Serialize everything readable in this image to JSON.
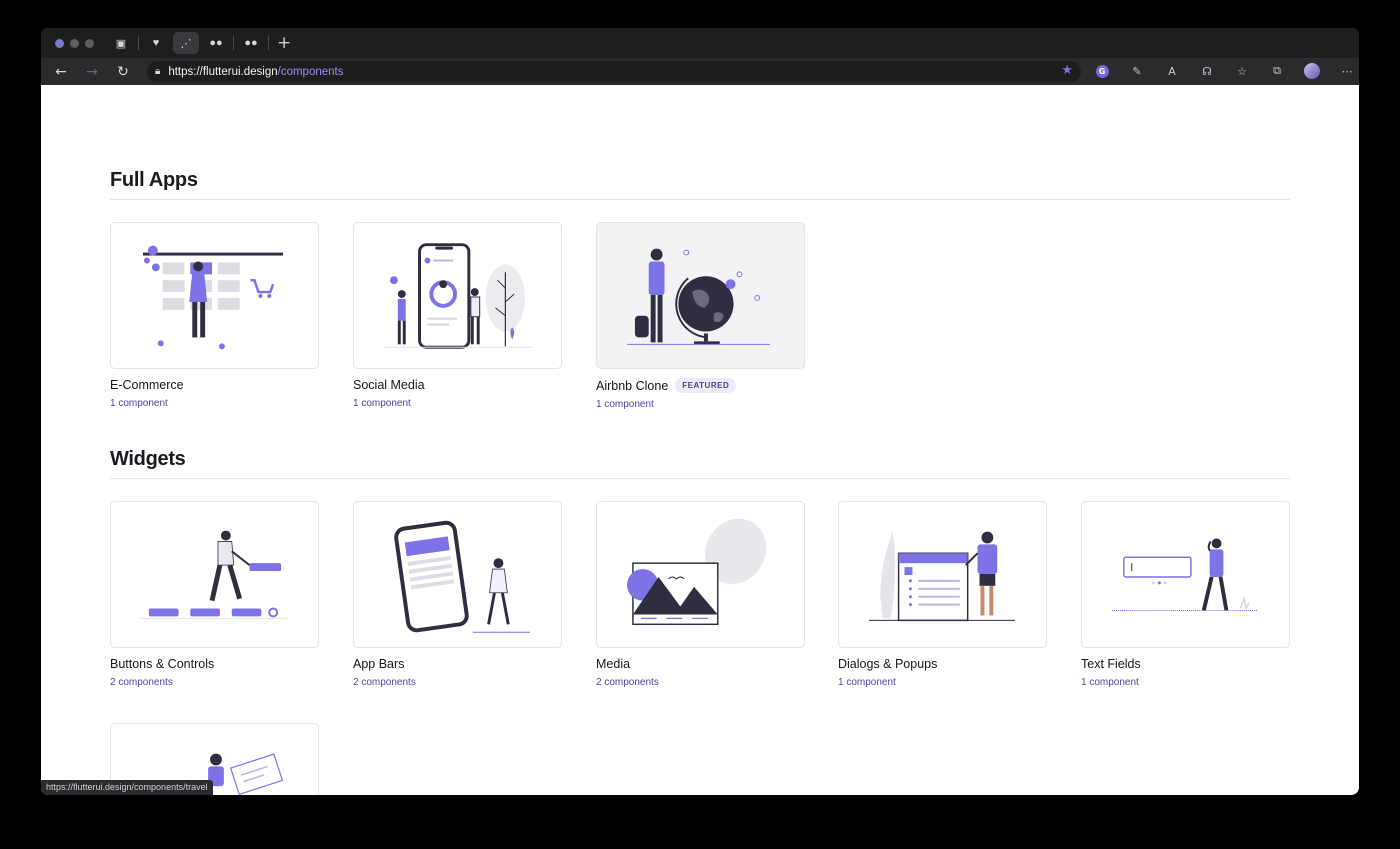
{
  "browser": {
    "url_host": "https://flutterui.design",
    "url_path": "/components",
    "status_url": "https://flutterui.design/components/travel",
    "accent": "#7d72e6"
  },
  "sections": {
    "full_apps": {
      "title": "Full Apps",
      "cards": [
        {
          "title": "E-Commerce",
          "count": "1 component"
        },
        {
          "title": "Social Media",
          "count": "1 component"
        },
        {
          "title": "Airbnb Clone",
          "badge": "FEATURED",
          "count": "1 component"
        }
      ]
    },
    "widgets": {
      "title": "Widgets",
      "cards": [
        {
          "title": "Buttons & Controls",
          "count": "2 components"
        },
        {
          "title": "App Bars",
          "count": "2 components"
        },
        {
          "title": "Media",
          "count": "2 components"
        },
        {
          "title": "Dialogs & Popups",
          "count": "1 component"
        },
        {
          "title": "Text Fields",
          "count": "1 component"
        }
      ]
    }
  },
  "colors": {
    "illustration_purple": "#7d72e6",
    "illustration_dark": "#2f2e41",
    "subtitle": "#4b46a0"
  }
}
